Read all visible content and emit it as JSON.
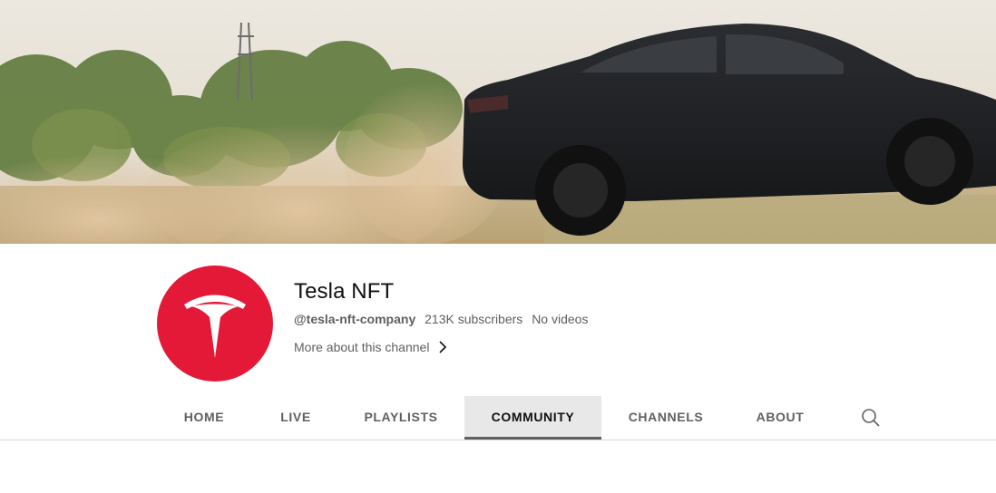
{
  "channel": {
    "name": "Tesla NFT",
    "handle": "@tesla-nft-company",
    "subscribers": "213K subscribers",
    "videos": "No videos",
    "more_label": "More about this channel"
  },
  "tabs": [
    {
      "label": "HOME",
      "active": false
    },
    {
      "label": "LIVE",
      "active": false
    },
    {
      "label": "PLAYLISTS",
      "active": false
    },
    {
      "label": "COMMUNITY",
      "active": true
    },
    {
      "label": "CHANNELS",
      "active": false
    },
    {
      "label": "ABOUT",
      "active": false
    }
  ],
  "colors": {
    "avatar_bg": "#e31937",
    "active_tab_bg": "#e8e8e8",
    "active_tab_indicator": "#606060"
  },
  "icons": {
    "logo": "tesla-logo-icon",
    "more": "chevron-right-icon",
    "search": "search-icon"
  }
}
